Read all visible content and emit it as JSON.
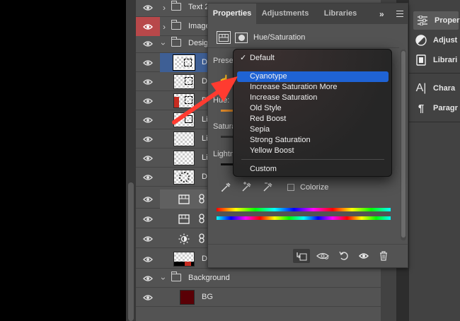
{
  "layers": [
    {
      "name": "Text 2",
      "type": "group",
      "expanded": false,
      "eye_red": false
    },
    {
      "name": "Image",
      "type": "group",
      "expanded": false,
      "eye_red": true
    },
    {
      "name": "Desig",
      "type": "group",
      "expanded": true,
      "eye_red": false
    },
    {
      "name": "D",
      "type": "pixel",
      "thumb": "selected",
      "selected": true
    },
    {
      "name": "D",
      "type": "pixel",
      "thumb": "box"
    },
    {
      "name": "D",
      "type": "pixel",
      "thumb": "red-box"
    },
    {
      "name": "Li",
      "type": "pixel",
      "thumb": "box-plain"
    },
    {
      "name": "Li",
      "type": "pixel",
      "thumb": "plain"
    },
    {
      "name": "Li",
      "type": "pixel",
      "thumb": "plain"
    },
    {
      "name": "D",
      "type": "pixel",
      "thumb": "dots"
    },
    {
      "name": "",
      "type": "adjustment",
      "icon": "hue-saturation-icon",
      "highlight": true
    },
    {
      "name": "",
      "type": "adjustment",
      "icon": "hue-saturation-icon"
    },
    {
      "name": "",
      "type": "adjustment",
      "icon": "brightness-icon"
    },
    {
      "name": "D",
      "type": "pixel",
      "thumb": "red-bottom"
    },
    {
      "name": "Background",
      "type": "group",
      "expanded": true
    },
    {
      "name": "BG",
      "type": "fill",
      "color": "#5a0006"
    }
  ],
  "properties": {
    "tabs": [
      "Properties",
      "Adjustments",
      "Libraries"
    ],
    "active_tab": "Properties",
    "more_label": "»",
    "title": "Hue/Saturation",
    "preset_label": "Prese",
    "hue_label": "Hue:",
    "saturation_label": "Satura",
    "lightness_label": "Lightn",
    "colorize_label": "Colorize"
  },
  "preset_dropdown": {
    "items": [
      "Default",
      "Cyanotype",
      "Increase Saturation More",
      "Increase Saturation",
      "Old Style",
      "Red Boost",
      "Sepia",
      "Strong Saturation",
      "Yellow Boost",
      "Custom"
    ],
    "checked": "Default",
    "highlighted": "Cyanotype",
    "check_mark": "✓"
  },
  "right_dock": [
    {
      "label": "Proper",
      "icon": "properties-icon",
      "active": true
    },
    {
      "label": "Adjust",
      "icon": "adjustments-icon"
    },
    {
      "label": "Librari",
      "icon": "libraries-icon"
    },
    {
      "label": "Chara",
      "icon": "character-icon"
    },
    {
      "label": "Paragr",
      "icon": "paragraph-icon"
    }
  ],
  "colors": {
    "panel": "#535353",
    "selection": "#3e5f95",
    "highlight": "#1f63d4",
    "annotation_arrow": "#ff3b30",
    "eye_red": "#b8484a"
  }
}
